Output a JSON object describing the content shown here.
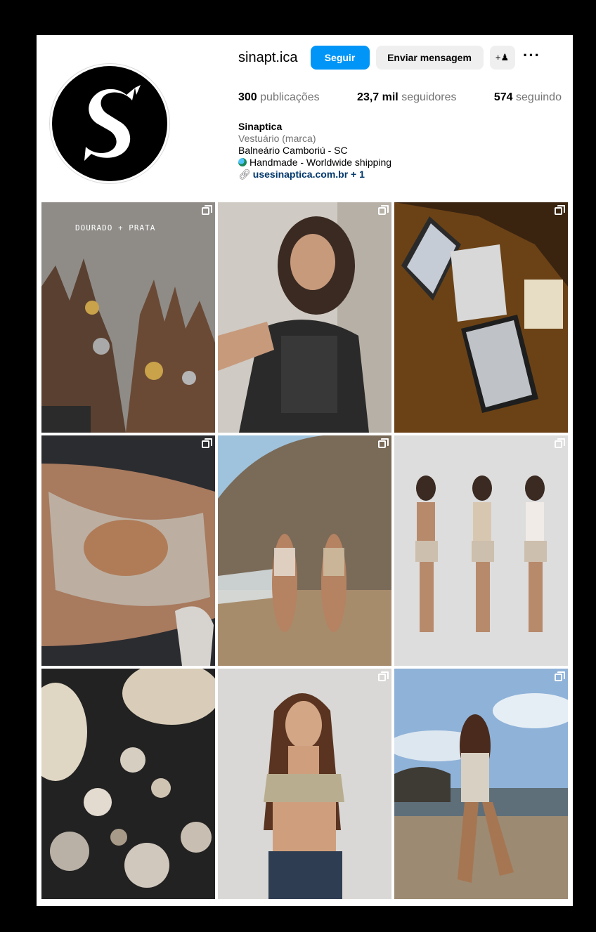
{
  "profile": {
    "username": "sinapt.ica",
    "follow_label": "Seguir",
    "message_label": "Enviar mensagem",
    "suggest_icon": "add-person-icon",
    "more_icon": "more-options-icon"
  },
  "stats": {
    "posts_count": "300",
    "posts_label": "publicações",
    "followers_count": "23,7 mil",
    "followers_label": "seguidores",
    "following_count": "574",
    "following_label": "seguindo"
  },
  "bio": {
    "name": "Sinaptica",
    "category": "Vestuário (marca)",
    "location": "Balneário Camboriú - SC",
    "tagline": "Handmade - Worldwide shipping",
    "link": "usesinaptica.com.br + 1"
  },
  "posts": [
    {
      "overlay_text": "DOURADO + PRATA",
      "multi": true
    },
    {
      "multi": true
    },
    {
      "multi": true
    },
    {
      "multi": true
    },
    {
      "multi": true
    },
    {
      "multi": true
    },
    {
      "multi": false
    },
    {
      "multi": true
    },
    {
      "multi": true
    }
  ],
  "colors": {
    "accent": "#0095f6",
    "secondary_button": "#efefef",
    "muted_text": "#737373",
    "link": "#00376b"
  }
}
